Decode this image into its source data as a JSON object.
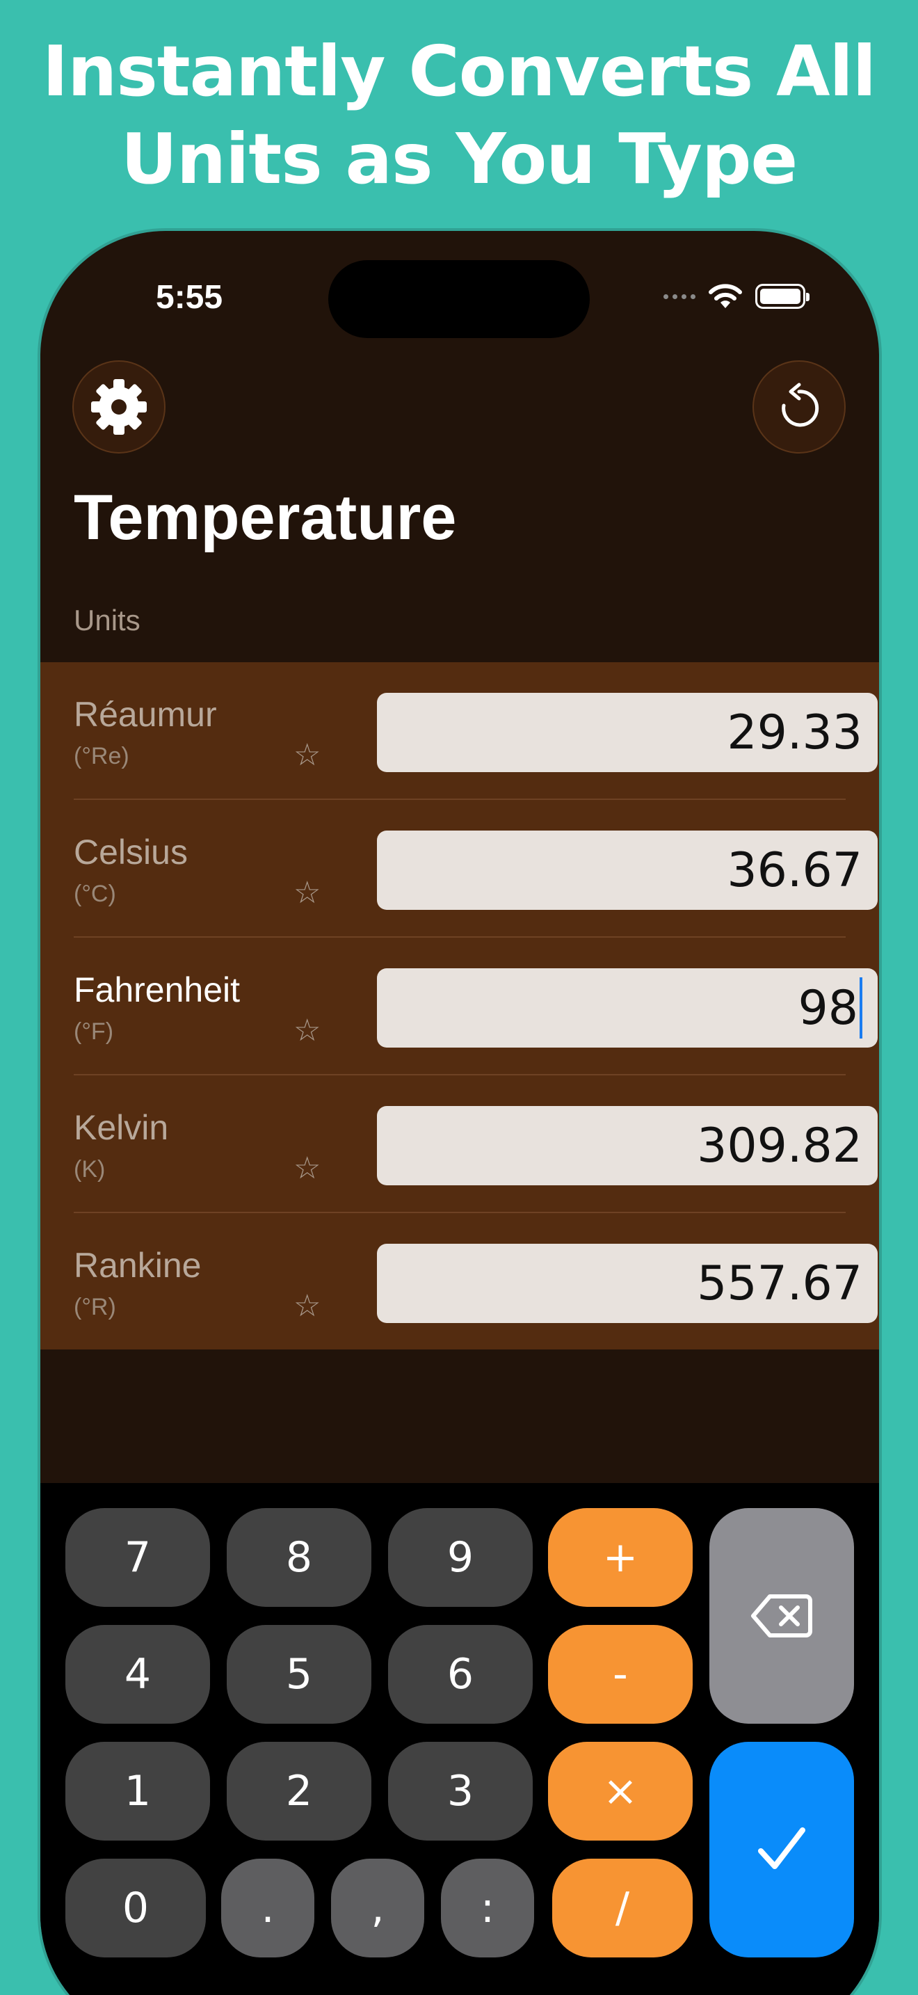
{
  "headline": {
    "line1": "Instantly Converts All",
    "line2": "Units as You Type"
  },
  "status_bar": {
    "time": "5:55",
    "icons": [
      "cellular-signal-icon",
      "wifi-icon",
      "battery-icon"
    ],
    "battery_level": 1.0
  },
  "header": {
    "settings_icon": "gear-icon",
    "reset_icon": "rotate-ccw-icon",
    "title": "Temperature",
    "section_label": "Units"
  },
  "units": [
    {
      "name": "Réaumur",
      "symbol": "(°Re)",
      "value": "29.33",
      "active": false
    },
    {
      "name": "Celsius",
      "symbol": "(°C)",
      "value": "36.67",
      "active": false
    },
    {
      "name": "Fahrenheit",
      "symbol": "(°F)",
      "value": "98",
      "active": true
    },
    {
      "name": "Kelvin",
      "symbol": "(K)",
      "value": "309.82",
      "active": false
    },
    {
      "name": "Rankine",
      "symbol": "(°R)",
      "value": "557.67",
      "active": false
    }
  ],
  "favorite_icon": "star-outline-icon",
  "keypad": {
    "digits": [
      "7",
      "8",
      "9",
      "4",
      "5",
      "6",
      "1",
      "2",
      "3",
      "0"
    ],
    "punctuation": [
      ".",
      ",",
      ":"
    ],
    "operators": [
      "+",
      "-",
      "×",
      "/"
    ],
    "backspace_icon": "backspace-icon",
    "done_icon": "checkmark-icon"
  },
  "colors": {
    "background": "#3abfae",
    "phone_background": "#21130a",
    "units_panel": "#542c10",
    "operator_key": "#f79433",
    "done_key": "#0a8cfa",
    "caret": "#1a7cf0"
  }
}
